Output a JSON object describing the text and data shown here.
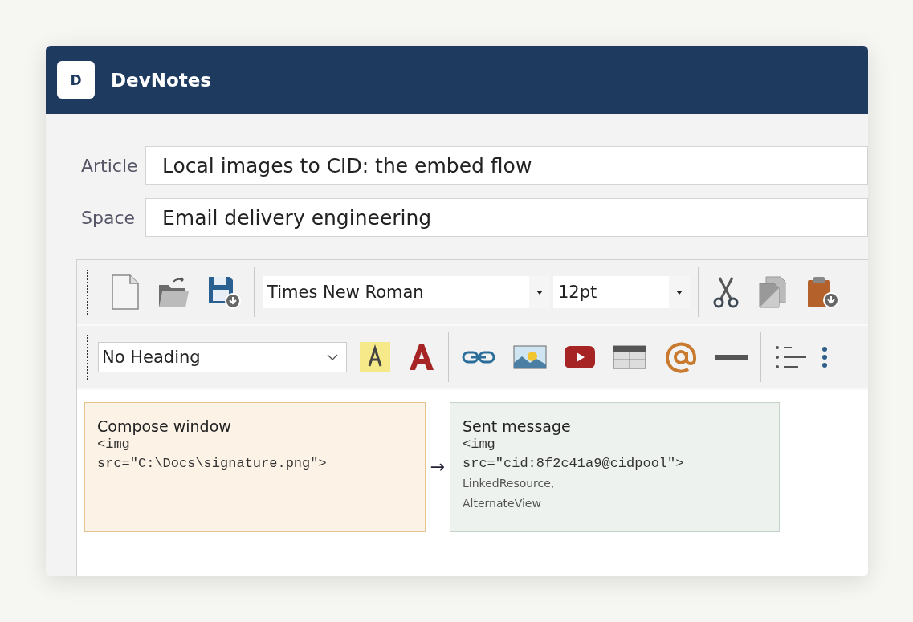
{
  "app": {
    "logo_letter": "D",
    "title": "DevNotes"
  },
  "fields": [
    {
      "label": "Article",
      "value": "Local images to CID: the embed flow"
    },
    {
      "label": "Space",
      "value": "Email delivery engineering"
    }
  ],
  "toolbar": {
    "font": "Times New Roman",
    "size": "12pt",
    "heading": "No Heading"
  },
  "diagram": {
    "arrow": "→",
    "boxes": [
      {
        "kind": "source",
        "title": "Compose window",
        "code": [
          "<img",
          "src=\"C:\\Docs\\signature.png\">"
        ]
      },
      {
        "kind": "result",
        "title": "Sent message",
        "code": [
          "<img",
          "src=\"cid:8f2c41a9@cidpool\">"
        ],
        "notes": [
          "LinkedResource,",
          "AlternateView"
        ]
      }
    ]
  }
}
